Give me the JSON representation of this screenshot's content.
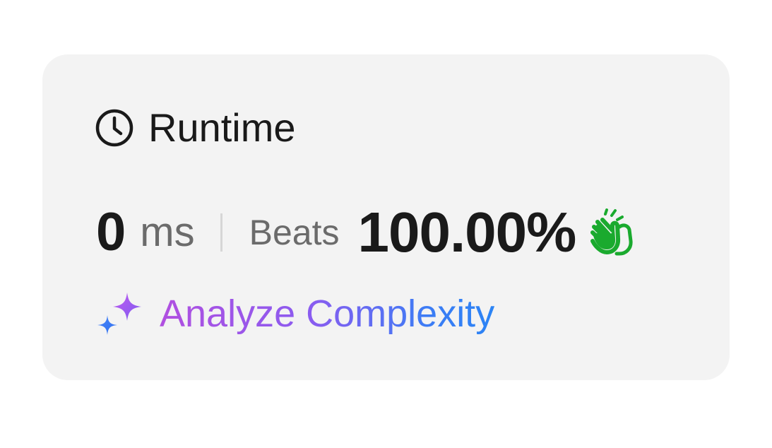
{
  "runtime_card": {
    "title": "Runtime",
    "clock_icon": "clock-icon",
    "runtime_value": "0",
    "runtime_unit": "ms",
    "beats_label": "Beats",
    "beats_value": "100.00%",
    "clap_icon": "clapping-hands-icon",
    "analyze_label": "Analyze Complexity",
    "sparkle_icon": "sparkle-icon",
    "colors": {
      "card_background": "#f3f3f3",
      "primary_text": "#1a1a1a",
      "secondary_text": "#6b6b6b",
      "clap_green": "#1aaa2e",
      "gradient_start": "#b14fe0",
      "gradient_end": "#2b84f5"
    }
  }
}
